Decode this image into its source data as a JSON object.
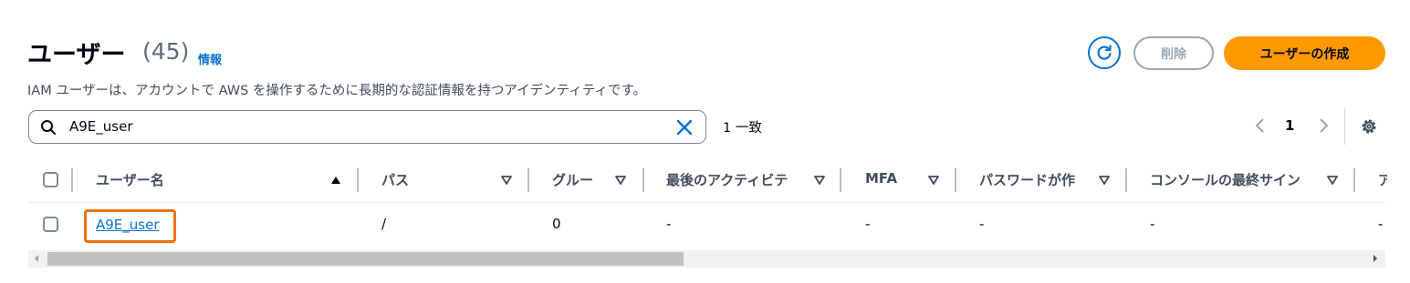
{
  "header": {
    "title": "ユーザー",
    "count": "(45)",
    "info_link": "情報",
    "description": "IAM ユーザーは、アカウントで AWS を操作するために長期的な認証情報を持つアイデンティティです。"
  },
  "actions": {
    "refresh_icon": "refresh-icon",
    "delete_label": "削除",
    "create_label": "ユーザーの作成"
  },
  "search": {
    "value": "A9E_user",
    "match_count": "1 一致"
  },
  "pagination": {
    "current_page": "1"
  },
  "table": {
    "columns": [
      "ユーザー名",
      "パス",
      "グルー",
      "最後のアクティビテ",
      "MFA",
      "パスワードが作",
      "コンソールの最終サイン",
      "ア"
    ],
    "rows": [
      {
        "user_name": "A9E_user",
        "path": "/",
        "groups": "0",
        "last_activity": "-",
        "mfa": "-",
        "password_age": "-",
        "console_last_signin": "-",
        "access_key": "-"
      }
    ]
  },
  "colors": {
    "accent": "#0972d3",
    "primary_button": "#ff9900",
    "highlight": "#ec7211"
  }
}
